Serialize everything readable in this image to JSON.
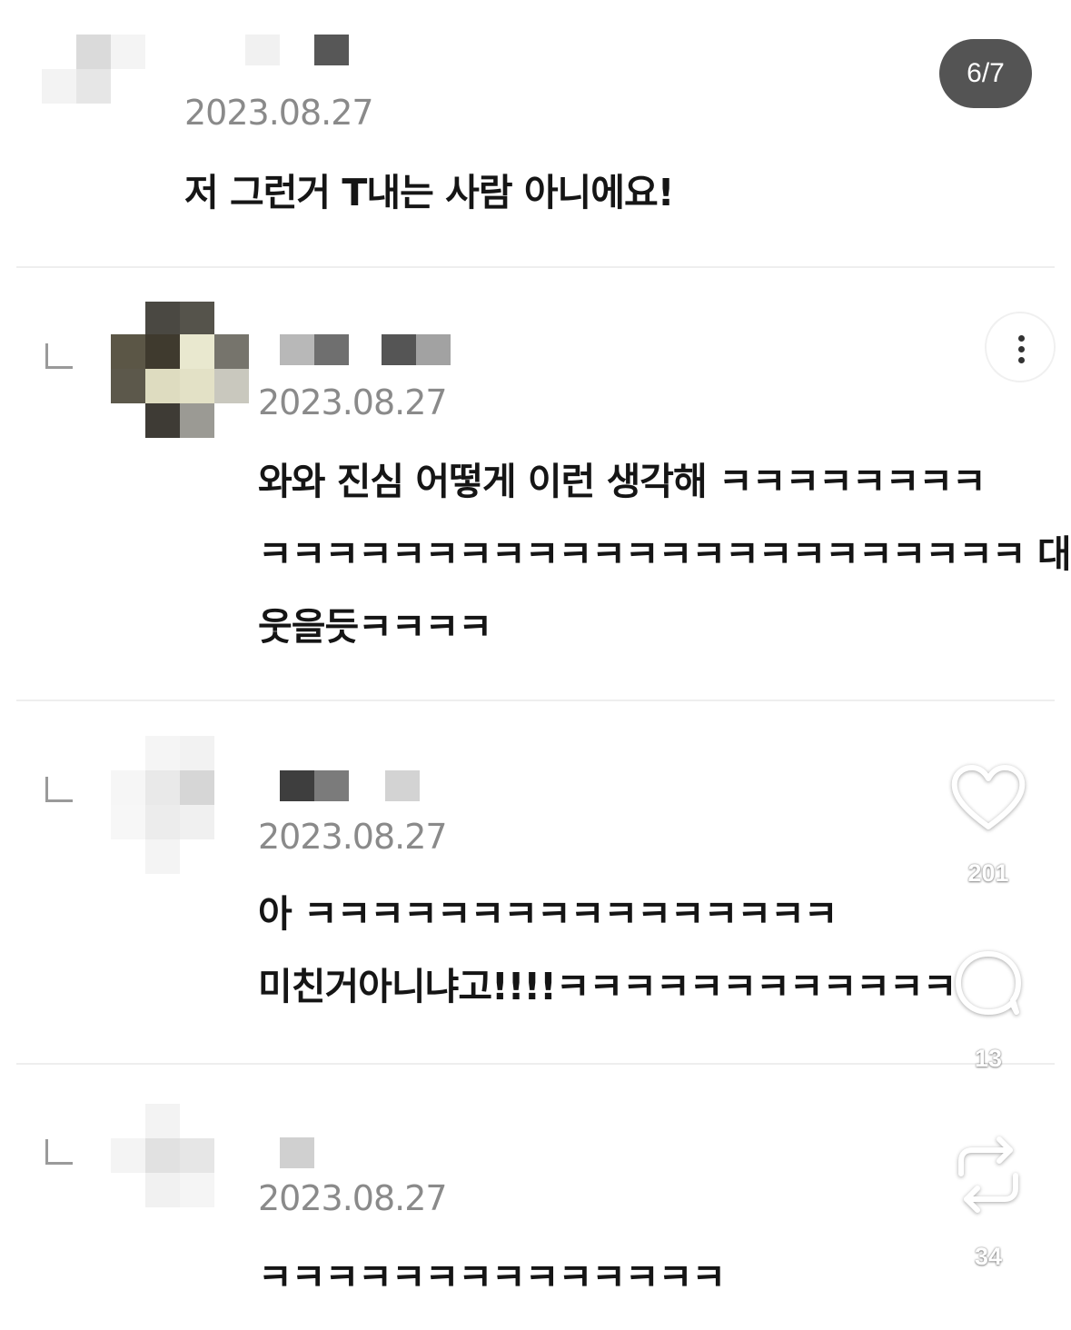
{
  "pager": {
    "label": "6/7"
  },
  "comments": [
    {
      "date": "2023.08.27",
      "lines": [
        "저 그런거 T내는 사람 아니에요!"
      ]
    },
    {
      "date": "2023.08.27",
      "lines": [
        "와와 진심 어떻게 이런 생각해 ㅋㅋㅋㅋㅋㅋㅋㅋ",
        "ㅋㅋㅋㅋㅋㅋㅋㅋㅋㅋㅋㅋㅋㅋㅋㅋㅋㅋㅋㅋㅋㅋㅋ 대리도",
        "웃을듯ㅋㅋㅋㅋ"
      ]
    },
    {
      "date": "2023.08.27",
      "lines": [
        "아 ㅋㅋㅋㅋㅋㅋㅋㅋㅋㅋㅋㅋㅋㅋㅋㅋ",
        "미친거아니냐고!!!!ㅋㅋㅋㅋㅋㅋㅋㅋㅋㅋㅋㅋ"
      ]
    },
    {
      "date": "2023.08.27",
      "lines": [
        "ㅋㅋㅋㅋㅋㅋㅋㅋㅋㅋㅋㅋㅋㅋ"
      ]
    }
  ],
  "actions": {
    "likes": "201",
    "comments": "13",
    "reposts": "34"
  },
  "icons": {
    "like": "heart-icon",
    "comment": "comment-bubble-icon",
    "repost": "repost-icon",
    "more": "more-vertical-icon",
    "reply": "reply-indent-icon"
  }
}
